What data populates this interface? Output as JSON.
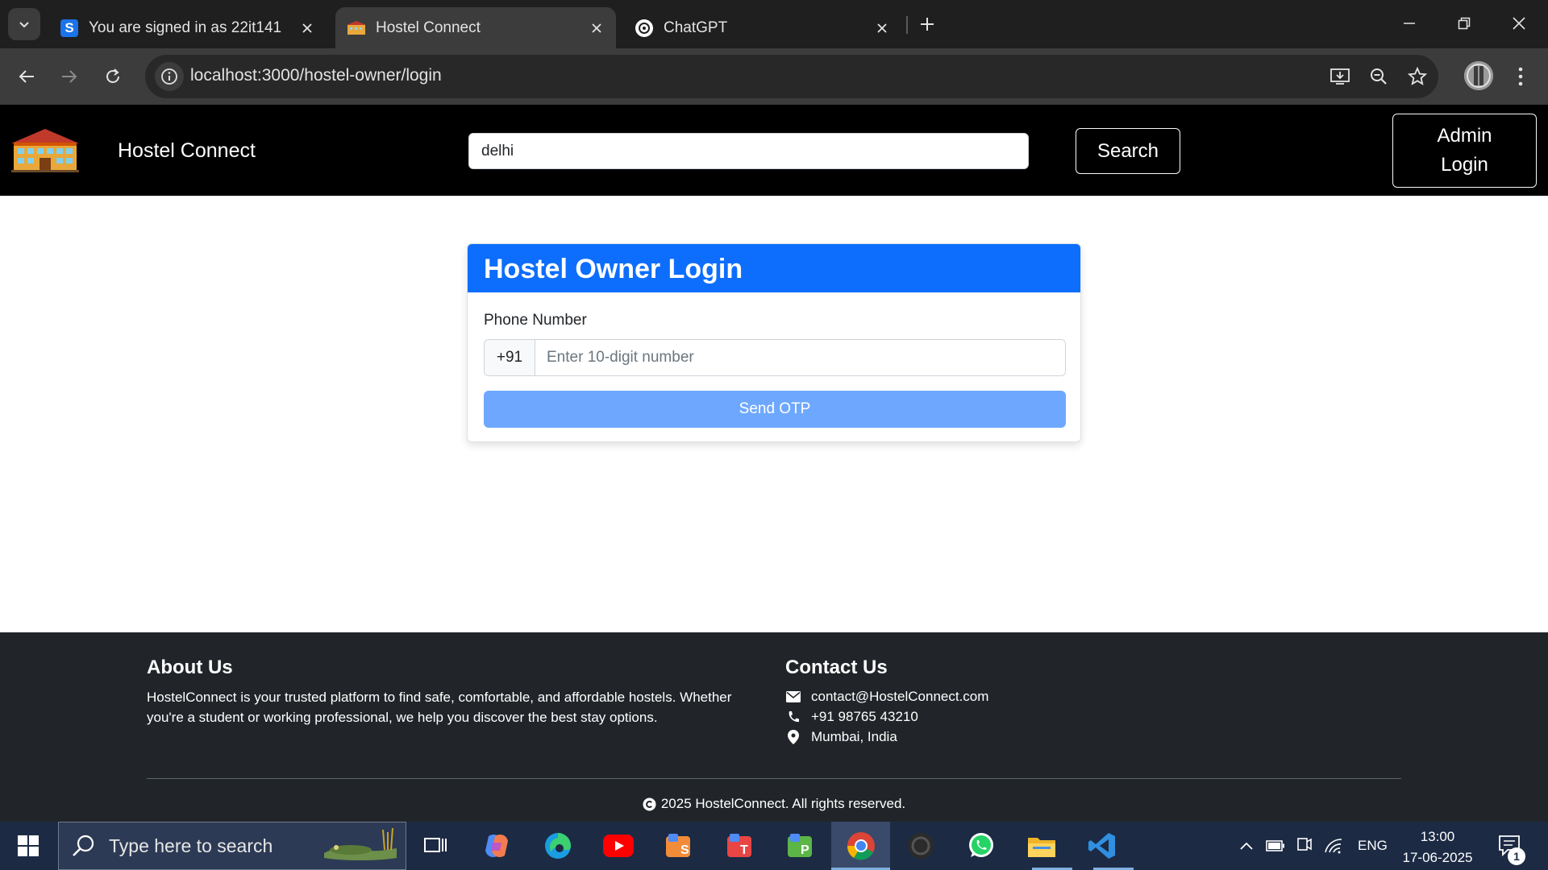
{
  "browser": {
    "tabs": [
      {
        "title": "You are signed in as 22it141",
        "favicon_letter": "S",
        "active": false
      },
      {
        "title": "Hostel Connect",
        "active": true
      },
      {
        "title": "ChatGPT",
        "active": false
      }
    ],
    "url": "localhost:3000/hostel-owner/login"
  },
  "navbar": {
    "brand": "Hostel Connect",
    "search_value": "delhi",
    "search_button": "Search",
    "admin_login_line1": "Admin",
    "admin_login_line2": "Login"
  },
  "login_card": {
    "title": "Hostel Owner Login",
    "phone_label": "Phone Number",
    "country_code": "+91",
    "phone_placeholder": "Enter 10-digit number",
    "send_otp_button": "Send OTP"
  },
  "footer": {
    "about_title": "About Us",
    "about_text": "HostelConnect is your trusted platform to find safe, comfortable, and affordable hostels. Whether you're a student or working professional, we help you discover the best stay options.",
    "contact_title": "Contact Us",
    "email": "contact@HostelConnect.com",
    "phone": "+91 98765 43210",
    "location": "Mumbai, India",
    "copyright": "2025 HostelConnect. All rights reserved."
  },
  "taskbar": {
    "search_placeholder": "Type here to search",
    "language": "ENG",
    "time": "13:00",
    "date": "17-06-2025",
    "notification_count": "1"
  },
  "colors": {
    "primary": "#0d6efd",
    "primary_disabled": "#6ea8fe",
    "footer_bg": "#212529",
    "nav_bg": "#000000"
  }
}
